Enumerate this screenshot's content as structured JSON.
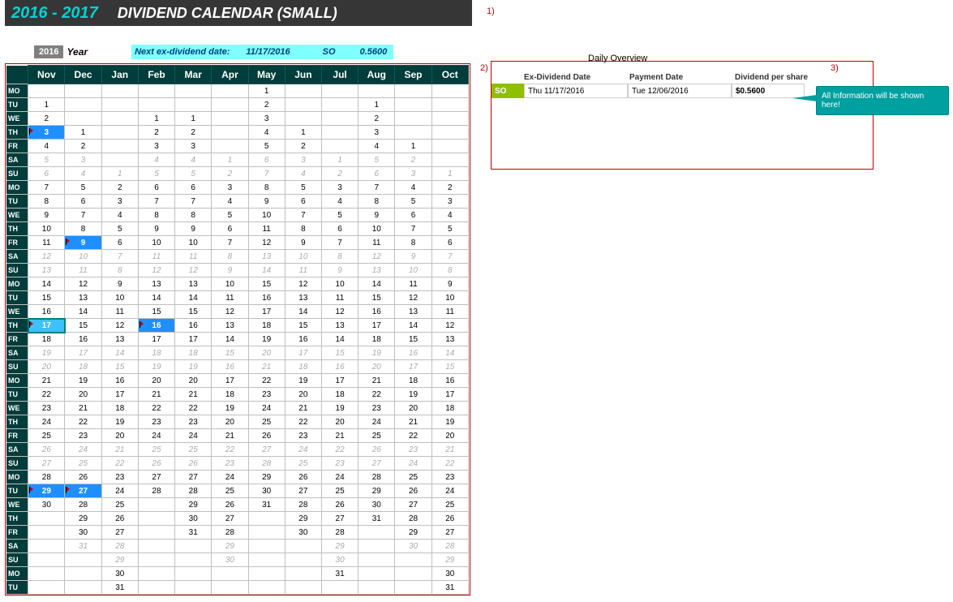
{
  "header": {
    "year_range": "2016 - 2017",
    "title": "DIVIDEND CALENDAR (SMALL)"
  },
  "info": {
    "year_value": "2016",
    "year_label": "Year",
    "next_label": "Next ex-dividend date:",
    "next_date": "11/17/2016",
    "next_ticker": "SO",
    "next_amount": "0.5600"
  },
  "annotations": {
    "a1": "1)",
    "a2": "2)",
    "a3": "3)"
  },
  "daily_overview": {
    "title": "Daily Overview",
    "headers": {
      "c1": "Ex-Dividend Date",
      "c2": "Payment Date",
      "c3": "Dividend per share"
    },
    "row": {
      "ticker": "SO",
      "ex_date": "Thu  11/17/2016",
      "pay_date": "Tue  12/06/2016",
      "dps": "$0.5600"
    }
  },
  "callout": "All Information will be shown here!",
  "months": [
    "Nov",
    "Dec",
    "Jan",
    "Feb",
    "Mar",
    "Apr",
    "May",
    "Jun",
    "Jul",
    "Aug",
    "Sep",
    "Oct"
  ],
  "days": [
    "MO",
    "TU",
    "WE",
    "TH",
    "FR",
    "SA",
    "SU",
    "MO",
    "TU",
    "WE",
    "TH",
    "FR",
    "SA",
    "SU",
    "MO",
    "TU",
    "WE",
    "TH",
    "FR",
    "SA",
    "SU",
    "MO",
    "TU",
    "WE",
    "TH",
    "FR",
    "SA",
    "SU",
    "MO",
    "TU",
    "WE",
    "TH",
    "FR",
    "SA",
    "SU",
    "MO",
    "TU"
  ],
  "calendar": [
    [
      "",
      "",
      "",
      "",
      "",
      "",
      "1",
      "",
      "",
      "",
      "",
      ""
    ],
    [
      "1",
      "",
      "",
      "",
      "",
      "",
      "2",
      "",
      "",
      "1",
      "",
      ""
    ],
    [
      "2",
      "",
      "",
      "1",
      "1",
      "",
      "3",
      "",
      "",
      "2",
      "",
      ""
    ],
    [
      "3",
      "1",
      "",
      "2",
      "2",
      "",
      "4",
      "1",
      "",
      "3",
      "",
      ""
    ],
    [
      "4",
      "2",
      "",
      "3",
      "3",
      "",
      "5",
      "2",
      "",
      "4",
      "1",
      ""
    ],
    [
      "5",
      "3",
      "",
      "4",
      "4",
      "1",
      "6",
      "3",
      "1",
      "5",
      "2",
      ""
    ],
    [
      "6",
      "4",
      "1",
      "5",
      "5",
      "2",
      "7",
      "4",
      "2",
      "6",
      "3",
      "1"
    ],
    [
      "7",
      "5",
      "2",
      "6",
      "6",
      "3",
      "8",
      "5",
      "3",
      "7",
      "4",
      "2"
    ],
    [
      "8",
      "6",
      "3",
      "7",
      "7",
      "4",
      "9",
      "6",
      "4",
      "8",
      "5",
      "3"
    ],
    [
      "9",
      "7",
      "4",
      "8",
      "8",
      "5",
      "10",
      "7",
      "5",
      "9",
      "6",
      "4"
    ],
    [
      "10",
      "8",
      "5",
      "9",
      "9",
      "6",
      "11",
      "8",
      "6",
      "10",
      "7",
      "5"
    ],
    [
      "11",
      "9",
      "6",
      "10",
      "10",
      "7",
      "12",
      "9",
      "7",
      "11",
      "8",
      "6"
    ],
    [
      "12",
      "10",
      "7",
      "11",
      "11",
      "8",
      "13",
      "10",
      "8",
      "12",
      "9",
      "7"
    ],
    [
      "13",
      "11",
      "8",
      "12",
      "12",
      "9",
      "14",
      "11",
      "9",
      "13",
      "10",
      "8"
    ],
    [
      "14",
      "12",
      "9",
      "13",
      "13",
      "10",
      "15",
      "12",
      "10",
      "14",
      "11",
      "9"
    ],
    [
      "15",
      "13",
      "10",
      "14",
      "14",
      "11",
      "16",
      "13",
      "11",
      "15",
      "12",
      "10"
    ],
    [
      "16",
      "14",
      "11",
      "15",
      "15",
      "12",
      "17",
      "14",
      "12",
      "16",
      "13",
      "11"
    ],
    [
      "17",
      "15",
      "12",
      "16",
      "16",
      "13",
      "18",
      "15",
      "13",
      "17",
      "14",
      "12"
    ],
    [
      "18",
      "16",
      "13",
      "17",
      "17",
      "14",
      "19",
      "16",
      "14",
      "18",
      "15",
      "13"
    ],
    [
      "19",
      "17",
      "14",
      "18",
      "18",
      "15",
      "20",
      "17",
      "15",
      "19",
      "16",
      "14"
    ],
    [
      "20",
      "18",
      "15",
      "19",
      "19",
      "16",
      "21",
      "18",
      "16",
      "20",
      "17",
      "15"
    ],
    [
      "21",
      "19",
      "16",
      "20",
      "20",
      "17",
      "22",
      "19",
      "17",
      "21",
      "18",
      "16"
    ],
    [
      "22",
      "20",
      "17",
      "21",
      "21",
      "18",
      "23",
      "20",
      "18",
      "22",
      "19",
      "17"
    ],
    [
      "23",
      "21",
      "18",
      "22",
      "22",
      "19",
      "24",
      "21",
      "19",
      "23",
      "20",
      "18"
    ],
    [
      "24",
      "22",
      "19",
      "23",
      "23",
      "20",
      "25",
      "22",
      "20",
      "24",
      "21",
      "19"
    ],
    [
      "25",
      "23",
      "20",
      "24",
      "24",
      "21",
      "26",
      "23",
      "21",
      "25",
      "22",
      "20"
    ],
    [
      "26",
      "24",
      "21",
      "25",
      "25",
      "22",
      "27",
      "24",
      "22",
      "26",
      "23",
      "21"
    ],
    [
      "27",
      "25",
      "22",
      "26",
      "26",
      "23",
      "28",
      "25",
      "23",
      "27",
      "24",
      "22"
    ],
    [
      "28",
      "26",
      "23",
      "27",
      "27",
      "24",
      "29",
      "26",
      "24",
      "28",
      "25",
      "23"
    ],
    [
      "29",
      "27",
      "24",
      "28",
      "28",
      "25",
      "30",
      "27",
      "25",
      "29",
      "26",
      "24"
    ],
    [
      "30",
      "28",
      "25",
      "",
      "29",
      "26",
      "31",
      "28",
      "26",
      "30",
      "27",
      "25"
    ],
    [
      "",
      "29",
      "26",
      "",
      "30",
      "27",
      "",
      "29",
      "27",
      "31",
      "28",
      "26"
    ],
    [
      "",
      "30",
      "27",
      "",
      "31",
      "28",
      "",
      "30",
      "28",
      "",
      "29",
      "27"
    ],
    [
      "",
      "31",
      "28",
      "",
      "",
      "29",
      "",
      "",
      "29",
      "",
      "30",
      "28"
    ],
    [
      "",
      "",
      "29",
      "",
      "",
      "30",
      "",
      "",
      "30",
      "",
      "",
      "29"
    ],
    [
      "",
      "",
      "30",
      "",
      "",
      "",
      "",
      "",
      "31",
      "",
      "",
      "30"
    ],
    [
      "",
      "",
      "31",
      "",
      "",
      "",
      "",
      "",
      "",
      "",
      "",
      "31"
    ]
  ],
  "flags": {
    "3-0": true,
    "11-1": true,
    "17-0": true,
    "17-3": true,
    "29-0": true,
    "29-1": true
  },
  "highlights": {
    "3-0": true,
    "11-1": true,
    "17-3": true,
    "29-0": true,
    "29-1": true
  },
  "selected": {
    "17-0": true
  }
}
